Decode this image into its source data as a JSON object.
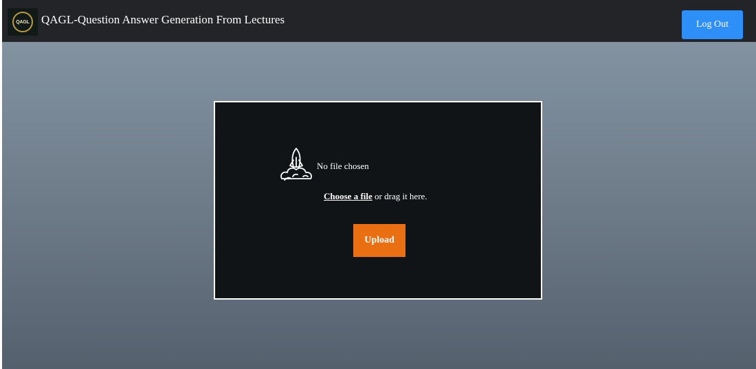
{
  "header": {
    "logo_text": "QAGL",
    "title": "QAGL-Question Answer Generation From Lectures",
    "logout_label": "Log Out"
  },
  "upload": {
    "icon": "rocket-launch-icon",
    "status": "No file chosen",
    "choose_label": "Choose a file",
    "drag_text": " or drag it here.",
    "button_label": "Upload"
  },
  "colors": {
    "navbar": "#222428",
    "background_top": "#8898a7",
    "background_bottom": "#55606d",
    "card": "#111417",
    "logout_blue": "#2f8ff8",
    "upload_orange": "#e96f12"
  }
}
